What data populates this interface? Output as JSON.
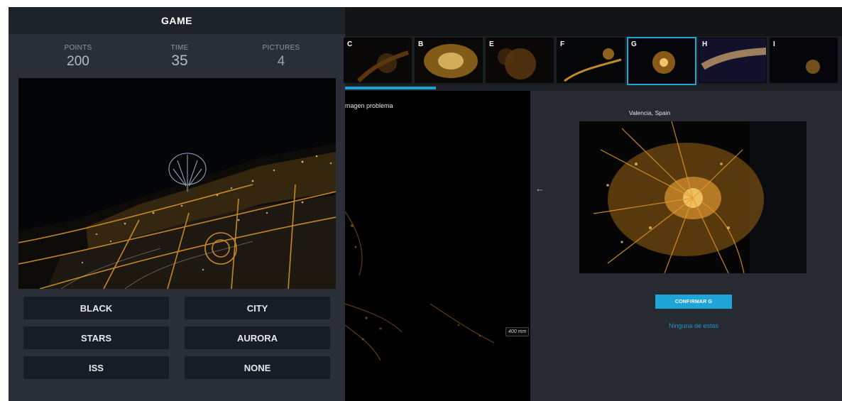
{
  "game": {
    "title": "GAME",
    "stats": [
      {
        "label": "POINTS",
        "value": "200"
      },
      {
        "label": "TIME",
        "value": "35"
      },
      {
        "label": "PICTURES",
        "value": "4"
      }
    ],
    "answers": [
      "BLACK",
      "CITY",
      "STARS",
      "AURORA",
      "ISS",
      "NONE"
    ]
  },
  "thumbnails": [
    {
      "letter": "C",
      "selected": false
    },
    {
      "letter": "B",
      "selected": false
    },
    {
      "letter": "E",
      "selected": false
    },
    {
      "letter": "F",
      "selected": false
    },
    {
      "letter": "G",
      "selected": true
    },
    {
      "letter": "H",
      "selected": false
    },
    {
      "letter": "I",
      "selected": false
    }
  ],
  "problem_view": {
    "title": "magen problema",
    "scale": "400 mm"
  },
  "match_view": {
    "arrow": "←",
    "title": "Valencia, Spain",
    "confirm_label": "CONFIRMAR G",
    "none_label": "Ninguna de estas"
  },
  "colors": {
    "accent": "#1ea4d6",
    "city_lights": "#e39a2c"
  }
}
